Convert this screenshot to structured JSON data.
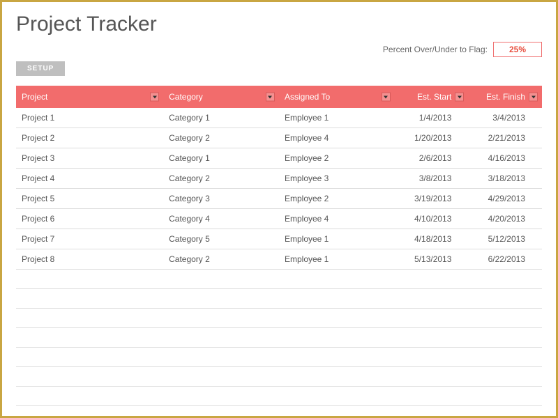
{
  "title": "Project Tracker",
  "flag": {
    "label": "Percent Over/Under to Flag:",
    "value": "25%"
  },
  "setup_button": "SETUP",
  "columns": {
    "project": "Project",
    "category": "Category",
    "assigned": "Assigned To",
    "est_start": "Est. Start",
    "est_finish": "Est. Finish"
  },
  "rows": [
    {
      "project": "Project 1",
      "category": "Category 1",
      "assigned": "Employee 1",
      "est_start": "1/4/2013",
      "est_finish": "3/4/2013"
    },
    {
      "project": "Project 2",
      "category": "Category 2",
      "assigned": "Employee 4",
      "est_start": "1/20/2013",
      "est_finish": "2/21/2013"
    },
    {
      "project": "Project 3",
      "category": "Category 1",
      "assigned": "Employee 2",
      "est_start": "2/6/2013",
      "est_finish": "4/16/2013"
    },
    {
      "project": "Project 4",
      "category": "Category 2",
      "assigned": "Employee 3",
      "est_start": "3/8/2013",
      "est_finish": "3/18/2013"
    },
    {
      "project": "Project 5",
      "category": "Category 3",
      "assigned": "Employee 2",
      "est_start": "3/19/2013",
      "est_finish": "4/29/2013"
    },
    {
      "project": "Project 6",
      "category": "Category 4",
      "assigned": "Employee 4",
      "est_start": "4/10/2013",
      "est_finish": "4/20/2013"
    },
    {
      "project": "Project 7",
      "category": "Category 5",
      "assigned": "Employee 1",
      "est_start": "4/18/2013",
      "est_finish": "5/12/2013"
    },
    {
      "project": "Project 8",
      "category": "Category 2",
      "assigned": "Employee 1",
      "est_start": "5/13/2013",
      "est_finish": "6/22/2013"
    }
  ]
}
